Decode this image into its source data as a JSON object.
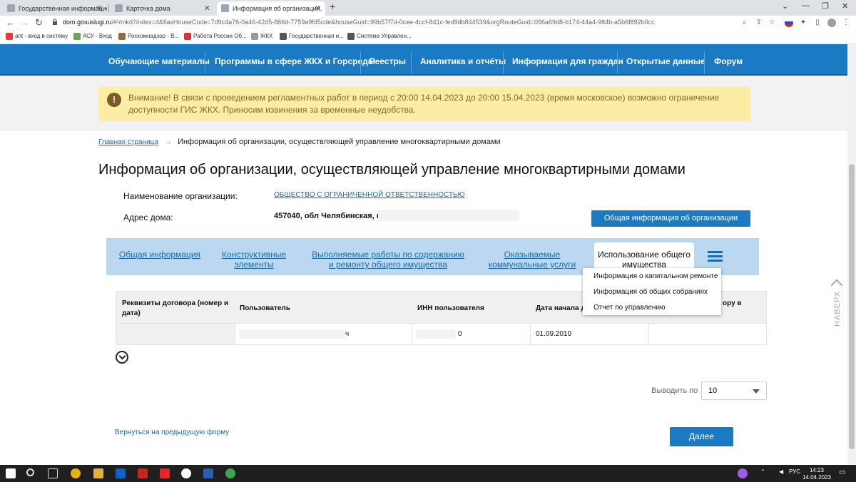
{
  "browser": {
    "tabs": [
      {
        "title": "Государственная информацио"
      },
      {
        "title": "Карточка дома"
      },
      {
        "title": "Информация об организации, "
      }
    ],
    "url_host": "dom.gosuslugi.ru",
    "url_rest": "/#!/mkd?index=4&fiasHouseCode=7d9c4a76-0a46-42d5-866d-7759a9fd5cde&houseGuid=99b57f7d-0cee-4ccf-841c-fed9db844539&orgRouteGuid=056a69d8-b174-44a4-984b-a5b6f892b0cc",
    "bookmarks": [
      "ant - вход в систему",
      "АСУ - Вход",
      "Роскомнадзор - В...",
      "Работа России Об...",
      "ЖКХ",
      "Государственная и...",
      "Система Управлен..."
    ]
  },
  "topnav": {
    "items": [
      "Обучающие материалы",
      "Программы в сфере ЖКХ и Горсреды",
      "Реестры",
      "Аналитика и отчёты",
      "Информация для граждан",
      "Открытые данные",
      "Форум"
    ]
  },
  "warning": {
    "icon": "exclamation-icon",
    "text": "Внимание! В связи с проведением регламентных работ в период с 20:00 14.04.2023 до 20:00 15.04.2023 (время московское) возможно ограничение доступности ГИС ЖКХ. Приносим извинения за временные неудобства."
  },
  "breadcrumb": {
    "home": "Главная страница",
    "arrow": "→",
    "current": "Информация об организации, осуществляющей управление многоквартирными домами"
  },
  "page_title": "Информация об организации, осуществляющей управление многоквартирными домами",
  "org": {
    "name_label": "Наименование организации:",
    "name_value": "ОБЩЕСТВО С ОГРАНИЧЕННОЙ ОТВЕТСТВЕННОСТЬЮ",
    "address_label": "Адрес дома:",
    "address_value": "457040, обл Челябинская, г",
    "general_info_button": "Общая информация об организации"
  },
  "subtabs": {
    "general": "Общая информация",
    "structural": "Конструктивные элементы",
    "works": "Выполняемые работы по содержанию и ремонту общего имущества",
    "utilities": "Оказываемые коммунальные услуги",
    "common_property": "Использование общего имущества"
  },
  "table": {
    "headers": [
      "Реквизиты договора (номер и дата)",
      "Пользователь",
      "ИНН пользователя",
      "Дата начала д",
      "ору в"
    ],
    "rows": [
      {
        "contract": "",
        "user": "ч",
        "inn": "0",
        "start_date": "01.09.2010",
        "other": ""
      }
    ]
  },
  "dropdown_menu": {
    "items": [
      "Информация о капитальном ремонте",
      "Информация об общих собраниях",
      "Отчет по управлению"
    ]
  },
  "pagination": {
    "label": "Выводить по",
    "value": "10"
  },
  "footer": {
    "back_link": "Вернуться на предыдущую форму",
    "next_button": "Далее"
  },
  "scroll_up": "НАВЕРХ",
  "taskbar": {
    "lang": "РУС",
    "time": "14:23",
    "date": "14.04.2023"
  }
}
